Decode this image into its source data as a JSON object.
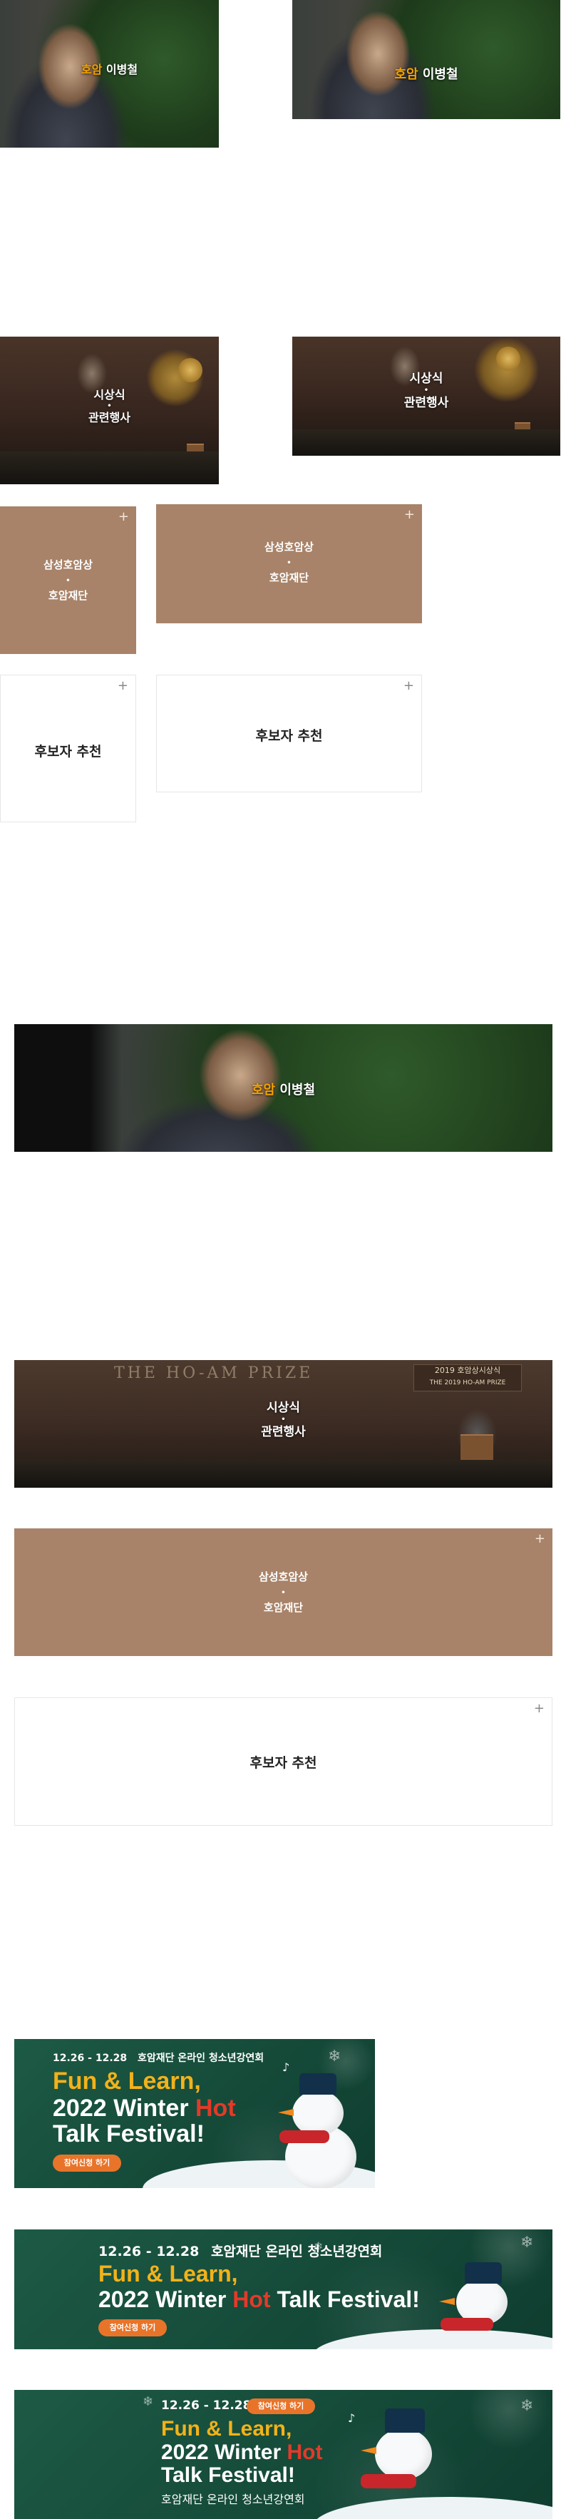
{
  "founder": {
    "accent_name": "호암",
    "name": "이병철"
  },
  "ceremony": {
    "line1": "시상식",
    "sep": "•",
    "line2": "관련행사",
    "stage_banner": "THE HO-AM PRIZE",
    "stage_sign_line1": "2019 호암상시상식",
    "stage_sign_line2": "THE 2019 HO-AM PRIZE"
  },
  "prize_tile": {
    "line1": "삼성호암상",
    "sep": "•",
    "line2": "호암재단",
    "plus": "+"
  },
  "nominee_tile": {
    "label": "후보자 추천",
    "plus": "+"
  },
  "banner": {
    "dates": "12.26 - 12.28",
    "org": "호암재단 온라인 청소년강연회",
    "headline1": "Fun & Learn,",
    "headline2_pre": "2022 Winter ",
    "headline2_hot": "Hot",
    "headline3": "Talk Festival!",
    "headline_oneline_pre": "2022 Winter ",
    "headline_oneline_post": " Talk Festival!",
    "cta": "참여신청 하기"
  },
  "colors": {
    "accent_orange": "#f2a200",
    "tile_brown": "#a88369",
    "banner_green": "#1d5a45",
    "hot_red": "#e23a2a",
    "fun_yellow": "#f2b21a"
  }
}
